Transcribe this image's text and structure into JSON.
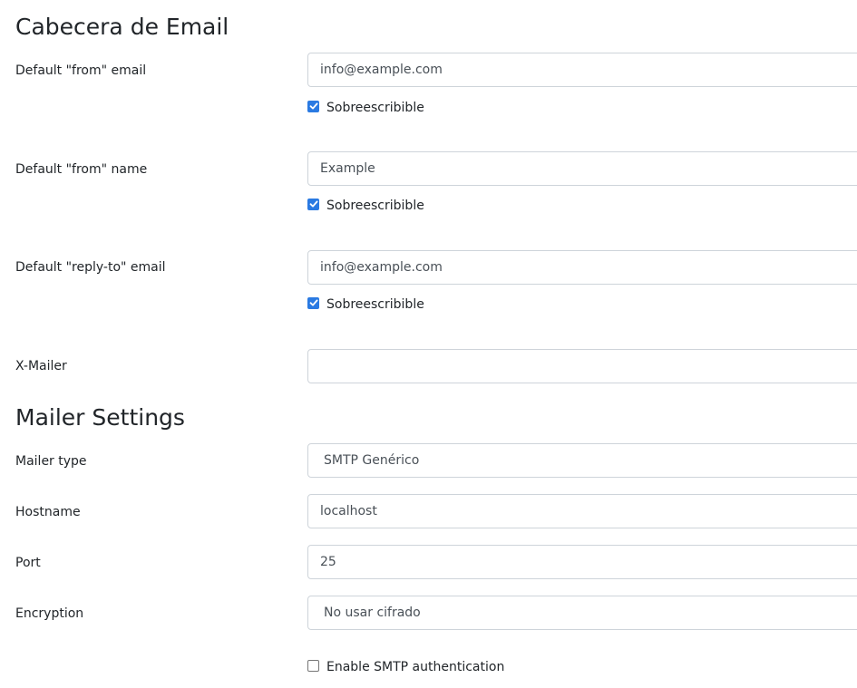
{
  "sections": {
    "header_title": "Cabecera de Email",
    "mailer_title": "Mailer Settings"
  },
  "email_header": {
    "from_email": {
      "label": "Default \"from\" email",
      "value": "info@example.com",
      "overridable_label": "Sobreescribible",
      "overridable_checked": true
    },
    "from_name": {
      "label": "Default \"from\" name",
      "value": "Example",
      "overridable_label": "Sobreescribible",
      "overridable_checked": true
    },
    "reply_to": {
      "label": "Default \"reply-to\" email",
      "value": "info@example.com",
      "overridable_label": "Sobreescribible",
      "overridable_checked": true
    },
    "x_mailer": {
      "label": "X-Mailer",
      "value": ""
    }
  },
  "mailer": {
    "type": {
      "label": "Mailer type",
      "value": "SMTP Genérico"
    },
    "hostname": {
      "label": "Hostname",
      "value": "localhost"
    },
    "port": {
      "label": "Port",
      "value": "25"
    },
    "encryption": {
      "label": "Encryption",
      "value": "No usar cifrado"
    },
    "smtp_auth": {
      "label": "Enable SMTP authentication",
      "checked": false
    }
  },
  "colors": {
    "accent": "#2a7ae2",
    "border": "#ced4da"
  }
}
